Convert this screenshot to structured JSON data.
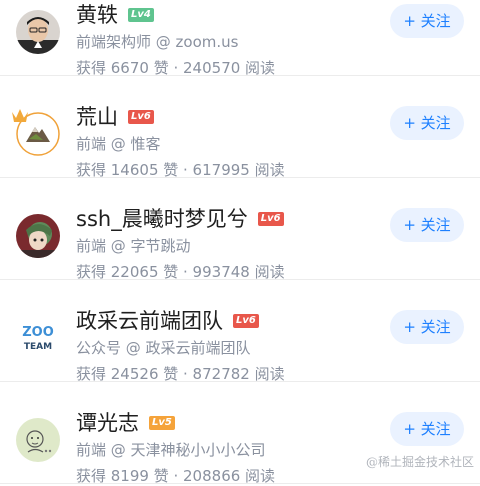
{
  "follow_label": "+ 关注",
  "colors": {
    "level_green": "#5fc48f",
    "level_red": "#e8574b",
    "level_orange": "#f5a33a",
    "follow_text": "#1e80ff",
    "follow_bg": "#eaf2ff"
  },
  "users": [
    {
      "name": "黄轶",
      "level": "Lv4",
      "level_color": "green",
      "desc": "前端架构师 @ zoom.us",
      "stats": "获得 6670 赞 · 240570 阅读",
      "avatar_icon": "person-with-glasses-photo"
    },
    {
      "name": "荒山",
      "level": "Lv6",
      "level_color": "red",
      "desc": "前端 @ 惟客",
      "stats": "获得 14605 赞 · 617995 阅读",
      "avatar_icon": "mountain-with-crown-icon"
    },
    {
      "name": "ssh_晨曦时梦见兮",
      "level": "Lv6",
      "level_color": "red",
      "desc": "前端 @ 字节跳动",
      "stats": "获得 22065 赞 · 993748 阅读",
      "avatar_icon": "anime-character-avatar"
    },
    {
      "name": "政采云前端团队",
      "level": "Lv6",
      "level_color": "red",
      "desc": "公众号 @ 政采云前端团队",
      "stats": "获得 24526 赞 · 872782 阅读",
      "avatar_icon": "zoo-team-logo"
    },
    {
      "name": "谭光志",
      "level": "Lv5",
      "level_color": "orange",
      "desc": "前端 @ 天津神秘小小小公司",
      "stats": "获得 8199 赞 · 208866 阅读",
      "avatar_icon": "sketch-character-avatar"
    }
  ],
  "zoo_logo": {
    "top": "ZOO",
    "bottom": "TEAM"
  },
  "watermark": "@稀土掘金技术社区"
}
